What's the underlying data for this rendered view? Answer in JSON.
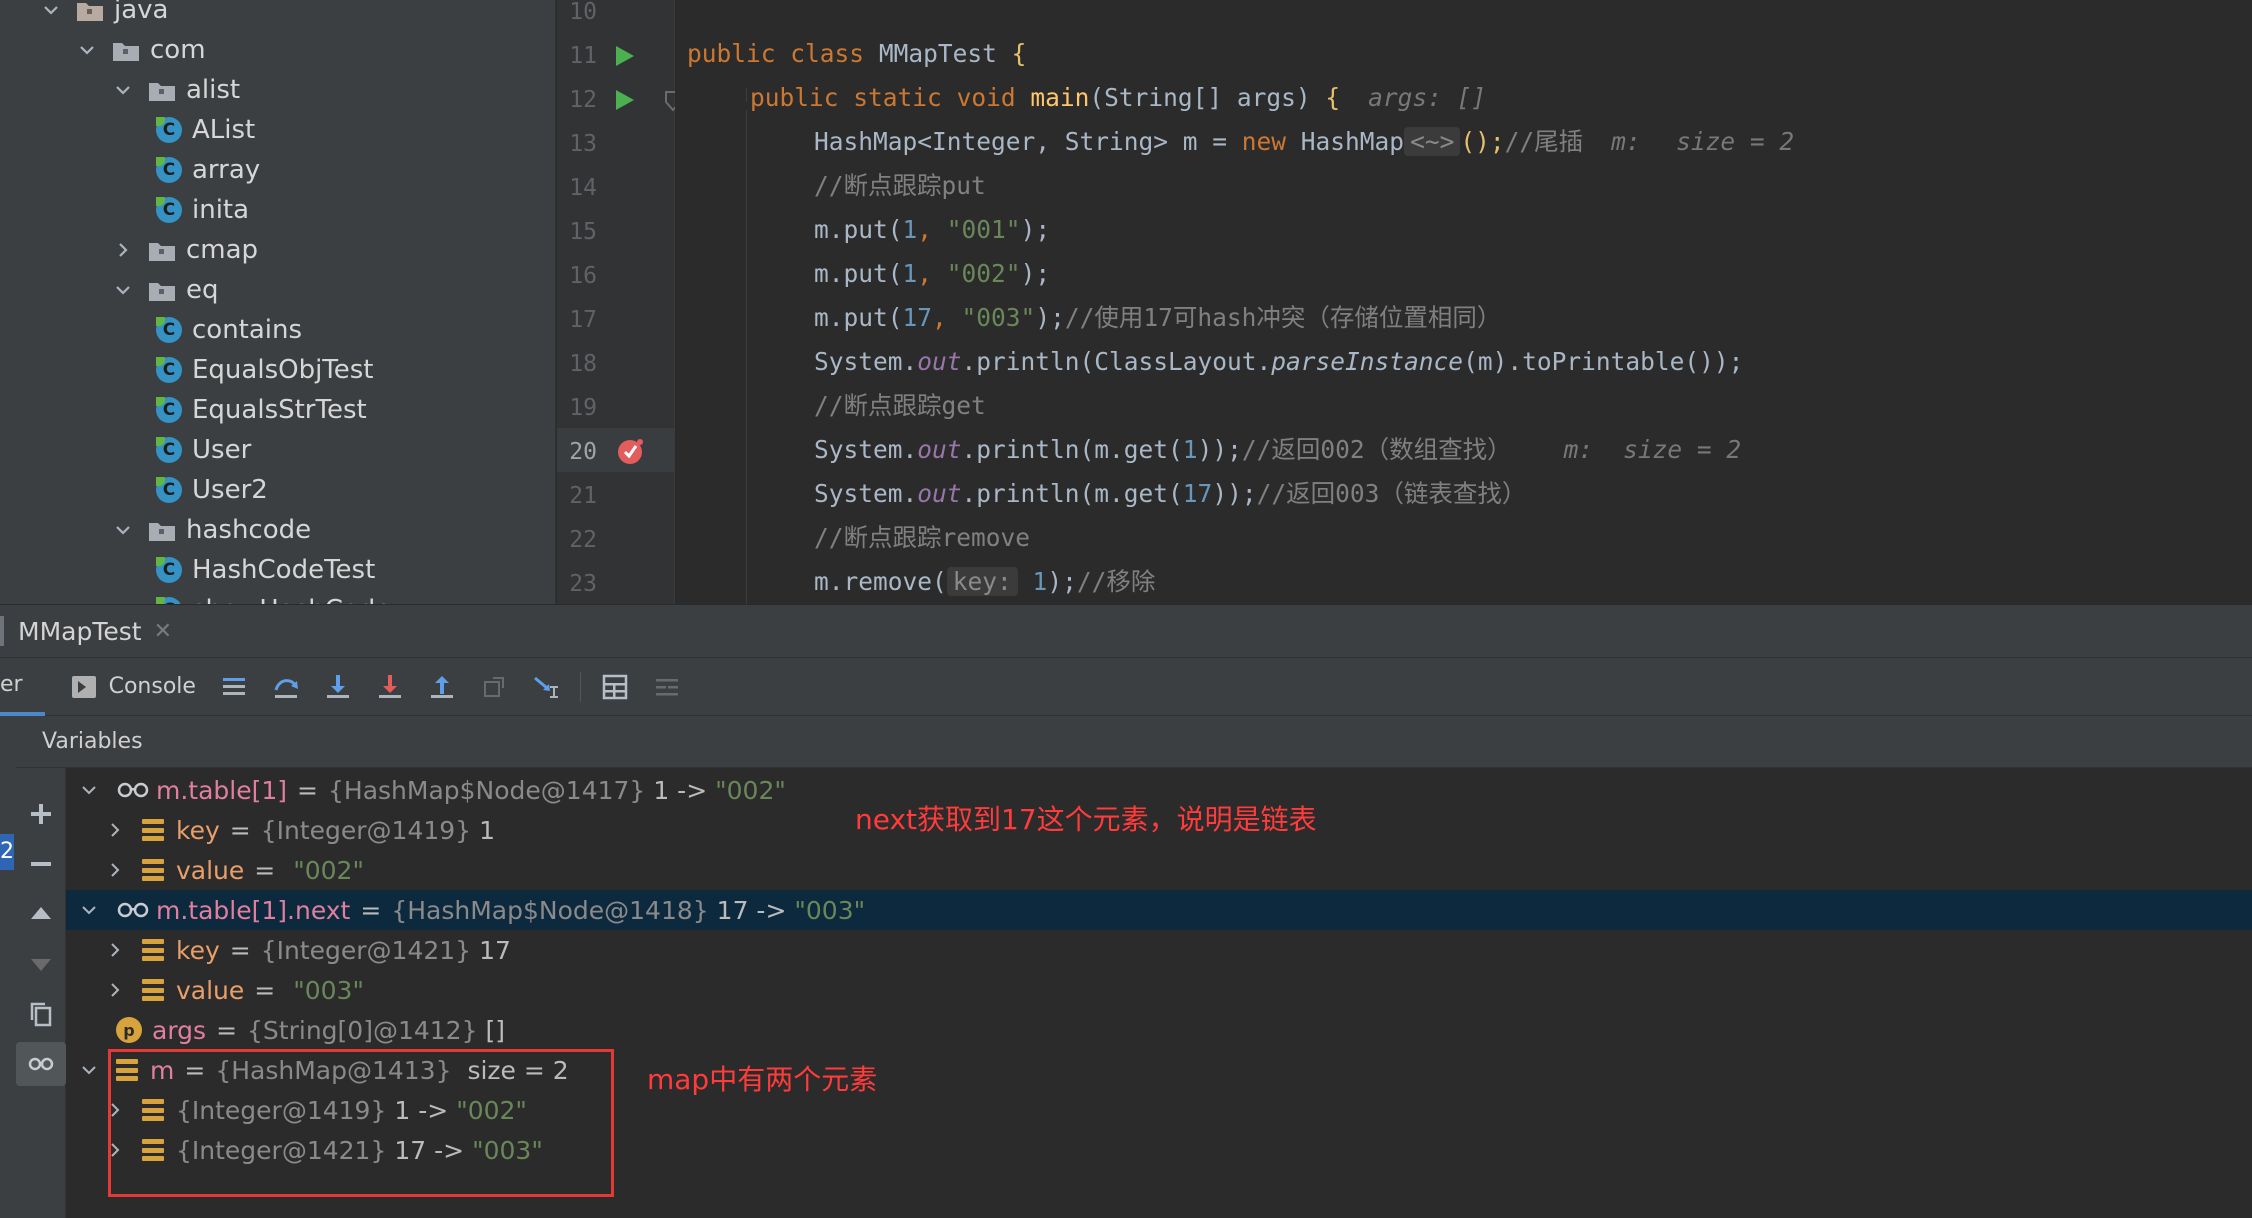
{
  "project_tree": {
    "items": [
      {
        "label": "java",
        "kind": "folder",
        "expanded": true,
        "depth": 0
      },
      {
        "label": "com",
        "kind": "folder",
        "expanded": true,
        "depth": 1
      },
      {
        "label": "alist",
        "kind": "folder",
        "expanded": true,
        "depth": 2
      },
      {
        "label": "AList",
        "kind": "class",
        "depth": 3
      },
      {
        "label": "array",
        "kind": "class",
        "depth": 3
      },
      {
        "label": "inita",
        "kind": "class",
        "depth": 3
      },
      {
        "label": "cmap",
        "kind": "folder",
        "expanded": false,
        "depth": 2
      },
      {
        "label": "eq",
        "kind": "folder",
        "expanded": true,
        "depth": 2
      },
      {
        "label": "contains",
        "kind": "class",
        "depth": 3
      },
      {
        "label": "EqualsObjTest",
        "kind": "class",
        "depth": 3
      },
      {
        "label": "EqualsStrTest",
        "kind": "class",
        "depth": 3
      },
      {
        "label": "User",
        "kind": "class",
        "depth": 3
      },
      {
        "label": "User2",
        "kind": "class",
        "depth": 3
      },
      {
        "label": "hashcode",
        "kind": "folder",
        "expanded": true,
        "depth": 2
      },
      {
        "label": "HashCodeTest",
        "kind": "class",
        "depth": 3
      },
      {
        "label": "showHashCode",
        "kind": "class",
        "depth": 3
      }
    ]
  },
  "editor": {
    "line_numbers": [
      "10",
      "11",
      "12",
      "13",
      "14",
      "15",
      "16",
      "17",
      "18",
      "19",
      "20",
      "21",
      "22",
      "23"
    ],
    "current_line": "20",
    "l11": {
      "kw1": "public",
      "kw2": "class",
      "name": "MMapTest",
      "brace": "{"
    },
    "l12": {
      "kw1": "public",
      "kw2": "static",
      "kw3": "void",
      "name": "main",
      "params": "(String[] args)",
      "brace": "{",
      "hint": "args: []"
    },
    "l13": {
      "code": "HashMap<Integer, String> m = ",
      "kw": "new",
      "type": "HashMap",
      "diamond": "<~>",
      "tail": "();",
      "comment": "//尾插",
      "hint_name": "m:",
      "hint_val": "size = 2"
    },
    "l14": {
      "comment": "//断点跟踪put"
    },
    "l15": {
      "pre": "m.put(",
      "num": "1",
      "sep": ", ",
      "str": "\"001\"",
      "post": ");"
    },
    "l16": {
      "pre": "m.put(",
      "num": "1",
      "sep": ", ",
      "str": "\"002\"",
      "post": ");"
    },
    "l17": {
      "pre": "m.put(",
      "num": "17",
      "sep": ", ",
      "str": "\"003\"",
      "post": ");",
      "comment": "//使用17可hash冲突（存储位置相同）"
    },
    "l18": {
      "pre": "System.",
      "out": "out",
      "mid": ".println(ClassLayout.",
      "method": "parseInstance",
      "post": "(m).toPrintable());"
    },
    "l19": {
      "comment": "//断点跟踪get"
    },
    "l20": {
      "pre": "System.",
      "out": "out",
      "mid": ".println(m.get(",
      "num": "1",
      "post": "));",
      "comment": "//返回002（数组查找）",
      "hint_name": "m:",
      "hint_val": "size = 2"
    },
    "l21": {
      "pre": "System.",
      "out": "out",
      "mid": ".println(m.get(",
      "num": "17",
      "post": "));",
      "comment": "//返回003（链表查找）"
    },
    "l22": {
      "comment": "//断点跟踪remove"
    },
    "l23": {
      "pre": "m.remove(",
      "chip": "key:",
      "num": "1",
      "post": ");",
      "comment": "//移除"
    }
  },
  "debug": {
    "tab_title": "MMapTest",
    "left_tab_fragment": "er",
    "console_label": "Console",
    "panel_title": "Variables",
    "left_badge": "2"
  },
  "variables": [
    {
      "kind": "watch",
      "expanded": true,
      "name": "m.table[1]",
      "eq": "=",
      "type": "{HashMap$Node@1417}",
      "value": "1 ->",
      "str": "\"002\"",
      "depth": 0
    },
    {
      "kind": "field",
      "expanded": false,
      "name": "key",
      "eq": "=",
      "type": "{Integer@1419}",
      "value": "1",
      "str": "",
      "depth": 1
    },
    {
      "kind": "field",
      "expanded": false,
      "name": "value",
      "eq": "=",
      "type": "",
      "value": "",
      "str": "\"002\"",
      "depth": 1
    },
    {
      "kind": "watch",
      "expanded": true,
      "name": "m.table[1].next",
      "eq": "=",
      "type": "{HashMap$Node@1418}",
      "value": "17 ->",
      "str": "\"003\"",
      "depth": 0,
      "selected": true
    },
    {
      "kind": "field",
      "expanded": false,
      "name": "key",
      "eq": "=",
      "type": "{Integer@1421}",
      "value": "17",
      "str": "",
      "depth": 1
    },
    {
      "kind": "field",
      "expanded": false,
      "name": "value",
      "eq": "=",
      "type": "",
      "value": "",
      "str": "\"003\"",
      "depth": 1
    },
    {
      "kind": "param",
      "name": "args",
      "eq": "=",
      "type": "{String[0]@1412}",
      "value": "[]",
      "str": "",
      "depth": 0
    },
    {
      "kind": "field",
      "expanded": true,
      "name": "m",
      "eq": "=",
      "type": "{HashMap@1413}",
      "value": " size = 2",
      "str": "",
      "depth": 0
    },
    {
      "kind": "entry",
      "expanded": false,
      "name": "",
      "eq": "",
      "type": "{Integer@1419}",
      "value": "1 ->",
      "str": "\"002\"",
      "depth": 1
    },
    {
      "kind": "entry",
      "expanded": false,
      "name": "",
      "eq": "",
      "type": "{Integer@1421}",
      "value": "17 ->",
      "str": "\"003\"",
      "depth": 1
    }
  ],
  "annotations": {
    "next_note": "next获取到17这个元素，说明是链表",
    "map_note": "map中有两个元素"
  },
  "colors": {
    "highlight_line": "#2d5c9e",
    "selected_var_row": "#0d293e",
    "annotation_red": "#ff3b3b",
    "run_green": "#4caf50"
  }
}
